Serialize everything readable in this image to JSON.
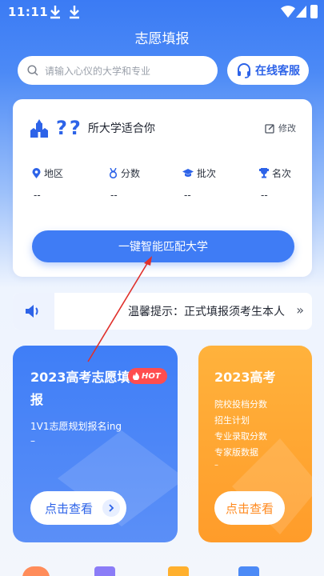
{
  "status_bar": {
    "time": "11:11"
  },
  "header": {
    "title": "志愿填报"
  },
  "search": {
    "placeholder": "请输入心仪的大学和专业"
  },
  "service_button": {
    "label": "在线客服"
  },
  "match_card": {
    "question_marks": "??",
    "subtitle": "所大学适合你",
    "edit_label": "修改",
    "metrics": [
      {
        "label": "地区",
        "value": "--",
        "icon": "location-pin-icon"
      },
      {
        "label": "分数",
        "value": "--",
        "icon": "medal-icon"
      },
      {
        "label": "批次",
        "value": "--",
        "icon": "graduation-cap-icon"
      },
      {
        "label": "名次",
        "value": "--",
        "icon": "trophy-icon"
      }
    ],
    "button_label": "一键智能匹配大学"
  },
  "notice": {
    "text": "温馨提示：正式填报须考生本人",
    "more": "»"
  },
  "promo_cards": [
    {
      "title": "2023高考志愿填报",
      "badge": "HOT",
      "subtitle": "1V1志愿规划报名ing",
      "dash": "–",
      "button_label": "点击查看",
      "color": "#3f7ef7"
    },
    {
      "title": "2023高考",
      "items": [
        "院校投档分数",
        "招生计划",
        "专业录取分数",
        "专家版数据"
      ],
      "dash": "–",
      "button_label": "点击查看",
      "color": "#ffa431"
    }
  ],
  "colors": {
    "primary": "#3f7cf5",
    "accent_orange": "#ff9c2a",
    "hot_red": "#ff4d4f"
  }
}
